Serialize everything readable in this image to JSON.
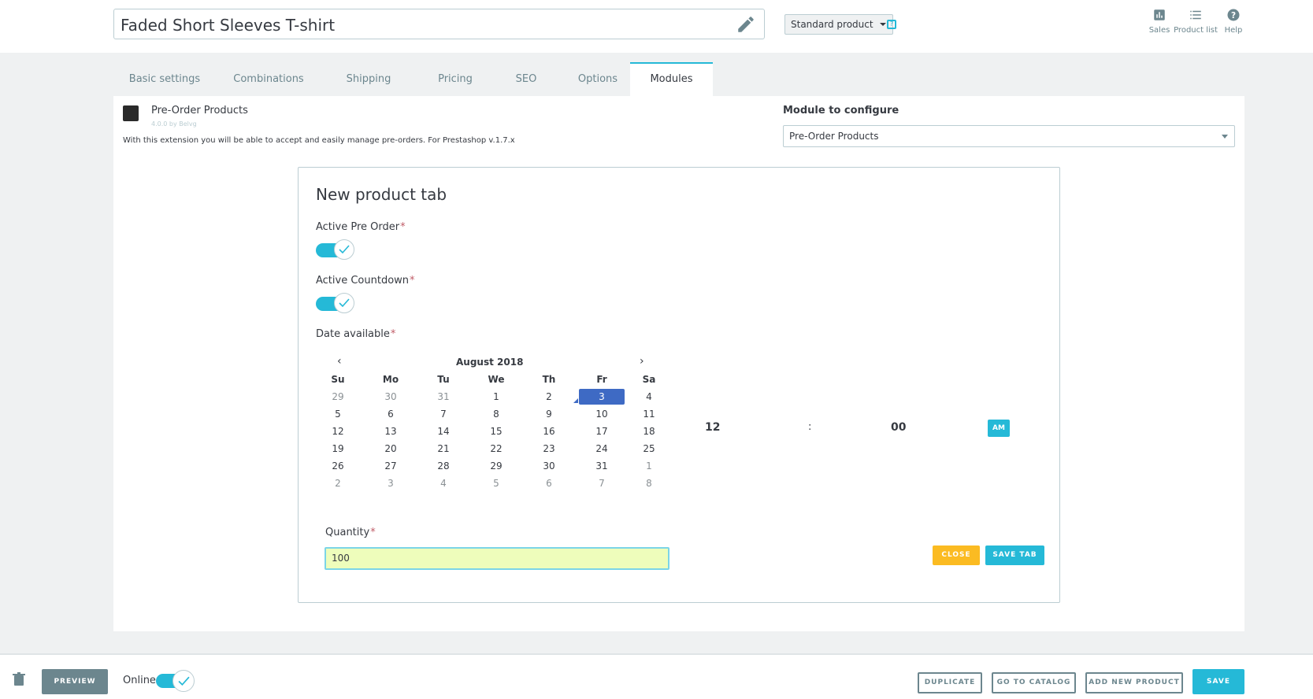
{
  "header": {
    "product_name": "Faded Short Sleeves T-shirt",
    "product_type": "Standard product",
    "help_badge": "?",
    "links": [
      {
        "label": "Sales",
        "icon": "bar-chart-icon"
      },
      {
        "label": "Product list",
        "icon": "list-icon"
      },
      {
        "label": "Help",
        "icon": "help-circle-icon"
      }
    ]
  },
  "tabs": [
    {
      "label": "Basic settings"
    },
    {
      "label": "Combinations"
    },
    {
      "label": "Shipping"
    },
    {
      "label": "Pricing"
    },
    {
      "label": "SEO"
    },
    {
      "label": "Options"
    },
    {
      "label": "Modules",
      "active": true
    }
  ],
  "module": {
    "name": "Pre-Order Products",
    "version": "4.0.0 by Belvg",
    "description": "With this extension you will be able to accept and easily manage pre-orders. For Prestashop v.1.7.x",
    "configure_label": "Module to configure",
    "configure_value": "Pre-Order Products"
  },
  "form": {
    "title": "New product tab",
    "active_preorder_label": "Active Pre Order",
    "active_preorder_value": true,
    "active_countdown_label": "Active Countdown",
    "active_countdown_value": true,
    "date_label": "Date available",
    "required_mark": "*",
    "quantity_label": "Quantity",
    "quantity_value": "100",
    "close_label": "CLOSE",
    "save_tab_label": "SAVE TAB"
  },
  "calendar": {
    "month_label": "August 2018",
    "prev": "‹",
    "next": "›",
    "weekdays": [
      "Su",
      "Mo",
      "Tu",
      "We",
      "Th",
      "Fr",
      "Sa"
    ],
    "weeks": [
      [
        "29",
        "30",
        "31",
        "1",
        "2",
        "3",
        "4"
      ],
      [
        "5",
        "6",
        "7",
        "8",
        "9",
        "10",
        "11"
      ],
      [
        "12",
        "13",
        "14",
        "15",
        "16",
        "17",
        "18"
      ],
      [
        "19",
        "20",
        "21",
        "22",
        "23",
        "24",
        "25"
      ],
      [
        "26",
        "27",
        "28",
        "29",
        "30",
        "31",
        "1"
      ],
      [
        "2",
        "3",
        "4",
        "5",
        "6",
        "7",
        "8"
      ]
    ],
    "selected": "3",
    "time_hour": "12",
    "time_sep": ":",
    "time_minute": "00",
    "ampm": "AM"
  },
  "footer": {
    "preview_label": "PREVIEW",
    "online_label": "Online",
    "online_value": true,
    "duplicate_label": "DUPLICATE",
    "go_to_catalog_label": "GO TO CATALOG",
    "add_new_product_label": "ADD NEW PRODUCT",
    "save_label": "SAVE"
  },
  "colors": {
    "accent": "#25b9d7",
    "warning": "#fbbb22",
    "selected_day": "#3e6ac4",
    "required": "#c05c67"
  }
}
